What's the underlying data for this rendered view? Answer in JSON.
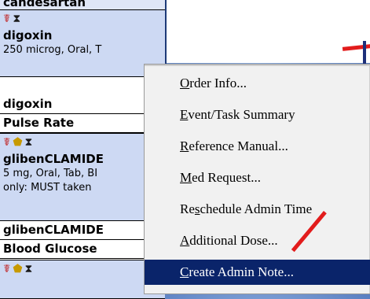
{
  "med_list": {
    "cut_top": "candesartan",
    "med1": {
      "name": "digoxin",
      "detail": "250 microg, Oral, T"
    },
    "headers1": [
      "digoxin",
      "Pulse Rate"
    ],
    "med2": {
      "name": "glibenCLAMIDE",
      "detail1": "5 mg, Oral, Tab, BI",
      "detail2": "only: MUST taken"
    },
    "headers2": [
      "glibenCLAMIDE",
      "Blood Glucose"
    ]
  },
  "context_menu": {
    "items": [
      {
        "prefix": "",
        "accel": "O",
        "rest": "rder Info...",
        "selected": false
      },
      {
        "prefix": "",
        "accel": "E",
        "rest": "vent/Task Summary",
        "selected": false
      },
      {
        "prefix": "",
        "accel": "R",
        "rest": "eference Manual...",
        "selected": false
      },
      {
        "prefix": "",
        "accel": "M",
        "rest": "ed Request...",
        "selected": false
      },
      {
        "prefix": "Re",
        "accel": "s",
        "rest": "chedule Admin Time",
        "selected": false
      },
      {
        "prefix": "",
        "accel": "A",
        "rest": "dditional Dose...",
        "selected": false
      },
      {
        "prefix": "",
        "accel": "C",
        "rest": "reate Admin Note...",
        "selected": true
      }
    ]
  },
  "icons": {
    "nurse": "☤",
    "clock": "⧗",
    "pill": "⬟"
  },
  "colors": {
    "menu_highlight": "#0a246a",
    "row_highlight": "#cdd9f3",
    "annotation": "#e21c1c"
  }
}
